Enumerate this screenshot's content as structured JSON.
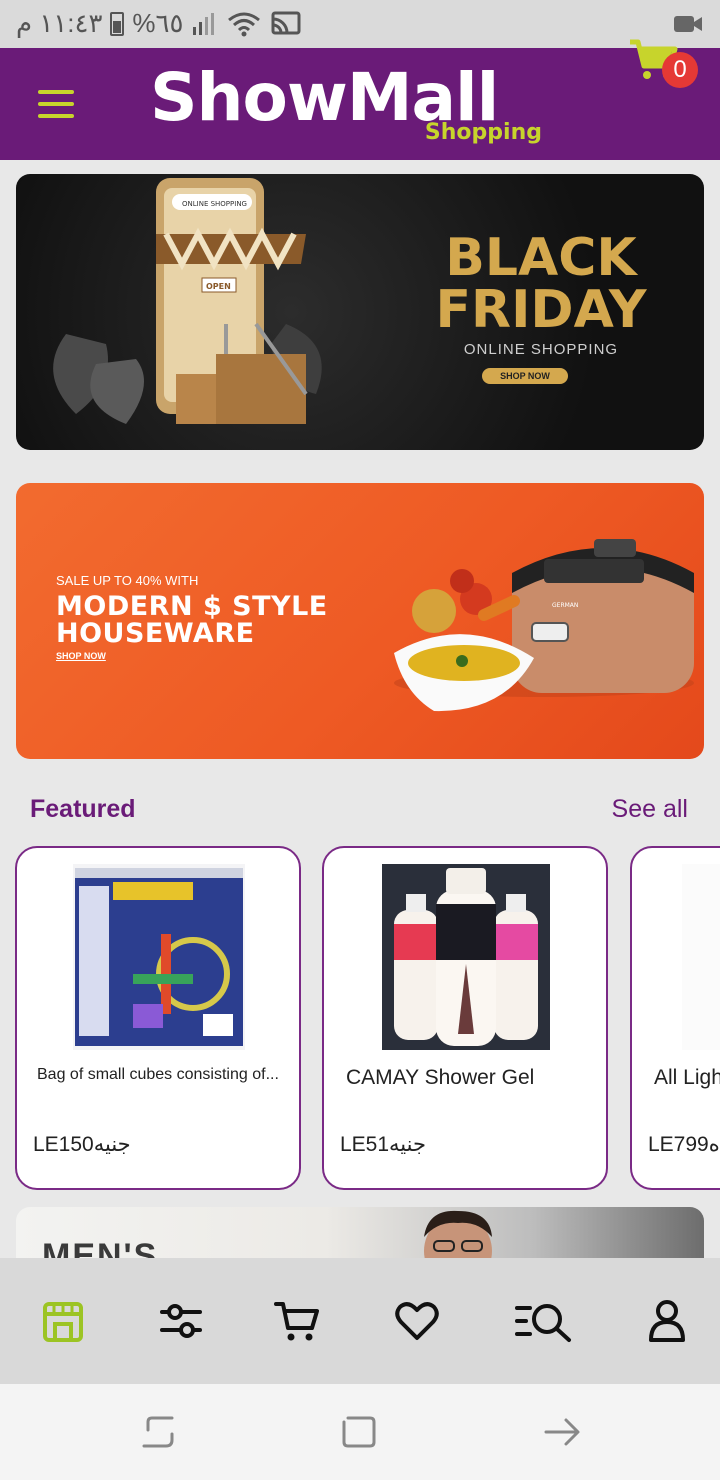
{
  "status_bar": {
    "time": "١١:٤٣ م",
    "battery": "%٦٥"
  },
  "header": {
    "logo_text": "ShowMall",
    "logo_subtitle": "Shopping",
    "cart_count": "0",
    "brand_color": "#6a1b78",
    "accent_color": "#c7d42c"
  },
  "banners": {
    "black_friday": {
      "title": "BLACK FRIDAY",
      "subtitle": "ONLINE SHOPPING",
      "button": "SHOP NOW",
      "storefront_sign": "OPEN",
      "phone_search": "ONLINE SHOPPING"
    },
    "houseware": {
      "small": "SALE UP TO 40% WITH",
      "title_line1": "MODERN $ STYLE",
      "title_line2": "HOUSEWARE",
      "link": "SHOP NOW",
      "product_brand": "GERMAN"
    },
    "men": {
      "title": "MEN'S"
    }
  },
  "featured": {
    "title": "Featured",
    "see_all": "See all",
    "products": [
      {
        "name": "Bag of small cubes consisting of...",
        "price": "LE150جنيه"
      },
      {
        "name": "CAMAY Shower Gel",
        "price": "LE51جنيه"
      },
      {
        "name": "All Ligh",
        "price": "LE799ه"
      }
    ]
  },
  "bottom_nav": {
    "items": [
      "home",
      "filters",
      "cart",
      "favorites",
      "search",
      "account"
    ],
    "active": "home",
    "active_color": "#9cc424"
  }
}
